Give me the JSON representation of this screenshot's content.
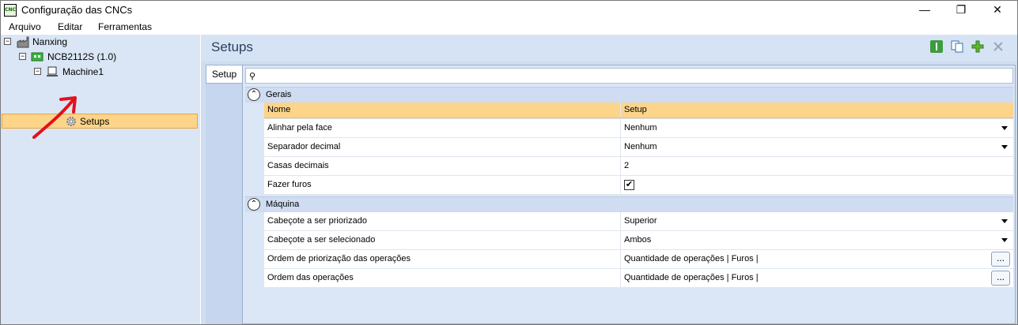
{
  "window": {
    "title": "Configuração das CNCs",
    "app_icon_text": "CNC"
  },
  "menu": {
    "items": [
      "Arquivo",
      "Editar",
      "Ferramentas"
    ]
  },
  "tree": {
    "root": {
      "label": "Nanxing",
      "expander": "⊟",
      "icon": "factory-icon"
    },
    "machine_group": {
      "label": "NCB2112S (1.0)",
      "expander": "⊟",
      "icon": "circuit-board-icon"
    },
    "machine": {
      "label": "Machine1",
      "expander": "⊟",
      "icon": "computer-icon"
    },
    "setups": {
      "label": "Setups",
      "icon": "gear-icon",
      "selected": true
    }
  },
  "panel": {
    "title": "Setups",
    "toolbar": {
      "info_icon": "info-icon",
      "copy_icon": "copy-icon",
      "add_icon": "add-icon",
      "delete_icon": "delete-icon"
    },
    "tab": "Setup",
    "search": {
      "placeholder": "",
      "icon": "key-icon"
    }
  },
  "grid": {
    "categories": [
      {
        "name": "Gerais",
        "header": {
          "col1": "Nome",
          "col2": "Setup"
        },
        "rows": [
          {
            "name": "Alinhar pela face",
            "value": "Nenhum",
            "editor": "dropdown"
          },
          {
            "name": "Separador decimal",
            "value": "Nenhum",
            "editor": "dropdown"
          },
          {
            "name": "Casas decimais",
            "value": "2",
            "editor": "text"
          },
          {
            "name": "Fazer furos",
            "value": "✔",
            "editor": "checkbox",
            "checked": true
          }
        ]
      },
      {
        "name": "Máquina",
        "rows": [
          {
            "name": "Cabeçote a ser priorizado",
            "value": "Superior",
            "editor": "dropdown"
          },
          {
            "name": "Cabeçote a ser selecionado",
            "value": "Ambos",
            "editor": "dropdown"
          },
          {
            "name": "Ordem de priorização das operações",
            "value": "Quantidade de operações | Furos |",
            "editor": "ellipsis",
            "button": "..."
          },
          {
            "name": "Ordem das operações",
            "value": "Quantidade de operações | Furos |",
            "editor": "ellipsis",
            "button": "..."
          }
        ]
      }
    ]
  },
  "colors": {
    "selection": "#fcd58a",
    "panel_bg": "#dae6f5",
    "accent_red": "#e3101b"
  }
}
